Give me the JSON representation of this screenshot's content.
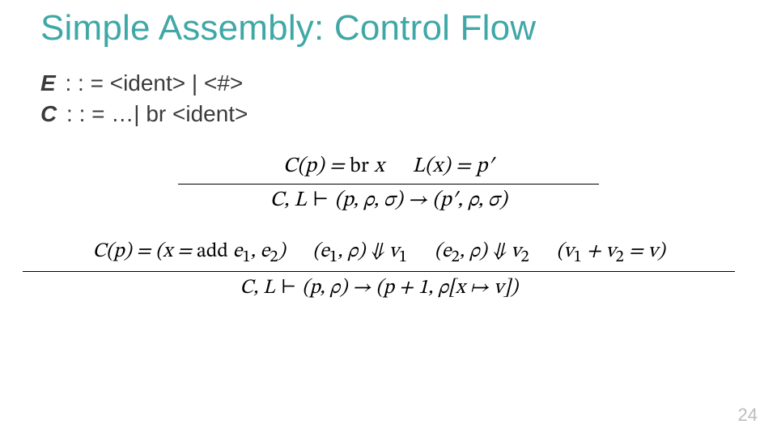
{
  "title": "Simple Assembly: Control Flow",
  "grammar": {
    "E": {
      "nt": "E",
      "rhs": " : : = <ident> | <#>"
    },
    "C": {
      "nt": "C",
      "rhs": " : : = …| br <ident>"
    }
  },
  "rule1": {
    "premise_a": "C(p) = br x",
    "premise_b": "L(x) = p′",
    "conclusion": "C, L ⊢ (p, ρ, σ) → (p′, ρ, σ)"
  },
  "rule2": {
    "premise_a": "C(p) = (x = add e₁, e₂)",
    "premise_b": "(e₁, ρ) ⇓ v₁",
    "premise_c": "(e₂, ρ) ⇓ v₂",
    "premise_d": "(v₁ + v₂ = v)",
    "conclusion": "C, L ⊢ (p, ρ) → (p + 1, ρ[x ↦ v])"
  },
  "page_number": "24"
}
